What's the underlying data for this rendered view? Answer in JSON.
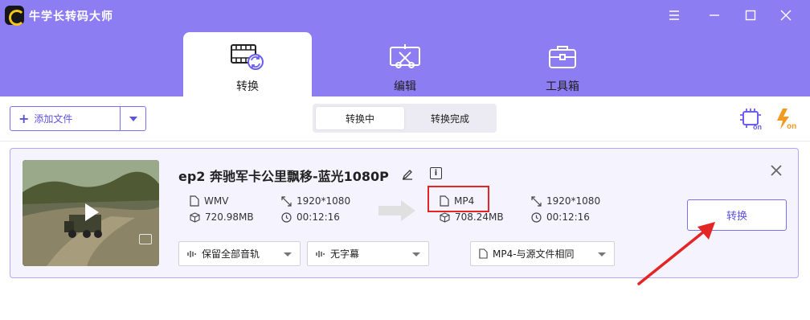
{
  "app": {
    "title": "牛学长转码大师"
  },
  "window_controls": {
    "menu_icon": "hamburger-icon",
    "min_icon": "minimize-icon",
    "max_icon": "maximize-icon",
    "close_icon": "close-icon"
  },
  "nav_tabs": [
    {
      "label": "转换",
      "icon": "convert-video-icon",
      "active": true
    },
    {
      "label": "编辑",
      "icon": "edit-crop-icon",
      "active": false
    },
    {
      "label": "工具箱",
      "icon": "toolbox-icon",
      "active": false
    }
  ],
  "toolbar": {
    "add_file_label": "添加文件",
    "segment": {
      "converting": "转换中",
      "completed": "转换完成"
    },
    "gpu_icon": "gpu-on-icon",
    "speed_icon": "speed-on-icon"
  },
  "file_item": {
    "title": "ep2 奔驰军卡公里飘移-蓝光1080P",
    "source": {
      "format": "WMV",
      "resolution": "1920*1080",
      "size": "720.98MB",
      "duration": "00:12:16"
    },
    "target": {
      "format": "MP4",
      "resolution": "1920*1080",
      "size": "708.24MB",
      "duration": "00:12:16"
    },
    "audio_track": "保留全部音轨",
    "subtitle": "无字幕",
    "output_format": "MP4-与源文件相同",
    "convert_label": "转换"
  },
  "colors": {
    "accent": "#8c7df2",
    "button_text": "#5d51e0",
    "highlight_box": "#e42525",
    "speed_icon": "#f29a1f"
  }
}
